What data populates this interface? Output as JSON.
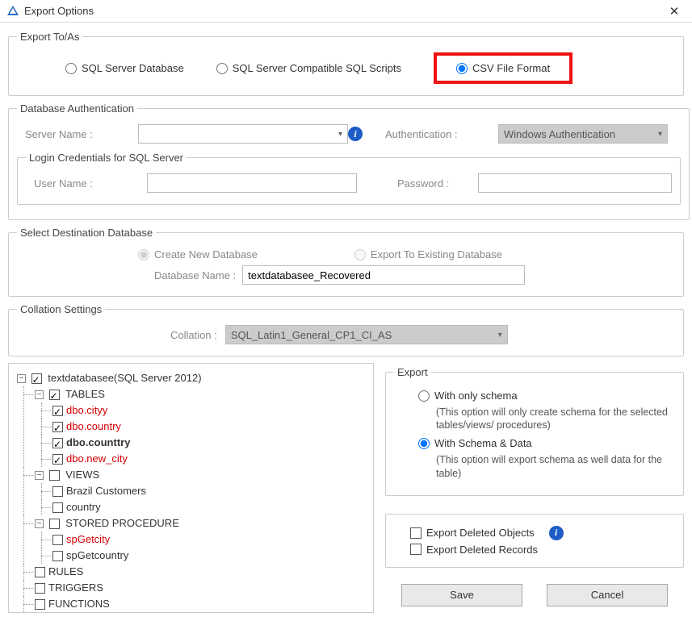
{
  "window": {
    "title": "Export Options"
  },
  "exportTo": {
    "legend": "Export To/As",
    "opt_sql_db": "SQL Server Database",
    "opt_sql_scripts": "SQL Server Compatible SQL Scripts",
    "opt_csv": "CSV File Format"
  },
  "dbAuth": {
    "legend": "Database Authentication",
    "server_label": "Server Name :",
    "auth_label": "Authentication :",
    "auth_value": "Windows Authentication"
  },
  "login": {
    "legend": "Login Credentials for SQL Server",
    "user_label": "User Name :",
    "pass_label": "Password :"
  },
  "dest": {
    "legend": "Select Destination Database",
    "create_label": "Create New Database",
    "existing_label": "Export To Existing Database",
    "dbname_label": "Database Name :",
    "dbname_value": "textdatabasee_Recovered"
  },
  "collation": {
    "legend": "Collation Settings",
    "label": "Collation :",
    "value": "SQL_Latin1_General_CP1_CI_AS"
  },
  "tree": {
    "root": "textdatabasee(SQL Server 2012)",
    "tables": "TABLES",
    "t1": "dbo.cityy",
    "t2": "dbo.country",
    "t3": "dbo.counttry",
    "t4": "dbo.new_city",
    "views": "VIEWS",
    "v1": "Brazil Customers",
    "v2": "country",
    "sp": "STORED PROCEDURE",
    "sp1": "spGetcity",
    "sp2": "spGetcountry",
    "rules": "RULES",
    "triggers": "TRIGGERS",
    "functions": "FUNCTIONS"
  },
  "export": {
    "legend": "Export",
    "only_schema": "With only schema",
    "only_schema_desc": "(This option will only create schema for the  selected tables/views/ procedures)",
    "schema_data": "With Schema & Data",
    "schema_data_desc": "(This option will export schema as well data for the table)",
    "del_obj": "Export Deleted Objects",
    "del_rec": "Export Deleted Records"
  },
  "buttons": {
    "save": "Save",
    "cancel": "Cancel"
  }
}
